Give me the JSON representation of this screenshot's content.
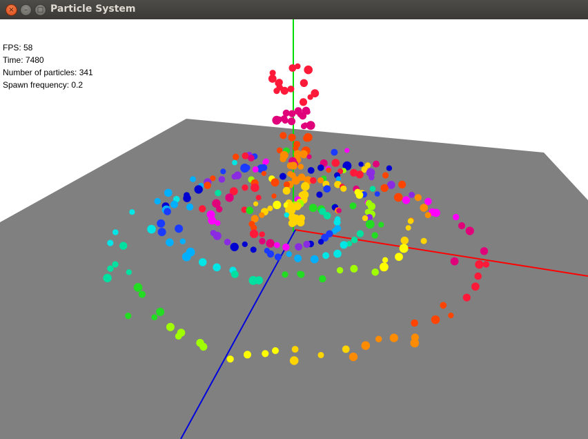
{
  "window": {
    "title": "Particle System",
    "controls": {
      "close": "×",
      "minimize": "–",
      "maximize": "□"
    }
  },
  "hud": {
    "fps": "FPS: 58",
    "time": "Time: 7480",
    "particles": "Number of particles: 341",
    "spawn": "Spawn frequency: 0.2"
  },
  "scene": {
    "ground_color": "#808080",
    "background_color": "#ffffff",
    "axes": {
      "x_color": "#ff0000",
      "y_color": "#00dd00",
      "z_color": "#0000dd"
    },
    "particle_colors": [
      "#ff1a3a",
      "#ff4400",
      "#ff8c00",
      "#ffd400",
      "#ffff00",
      "#a0ff00",
      "#22dd22",
      "#00e0a0",
      "#00e5e5",
      "#00b0ff",
      "#1a3aff",
      "#0000d0",
      "#8a2be2",
      "#ff00ff",
      "#e0007a"
    ]
  }
}
